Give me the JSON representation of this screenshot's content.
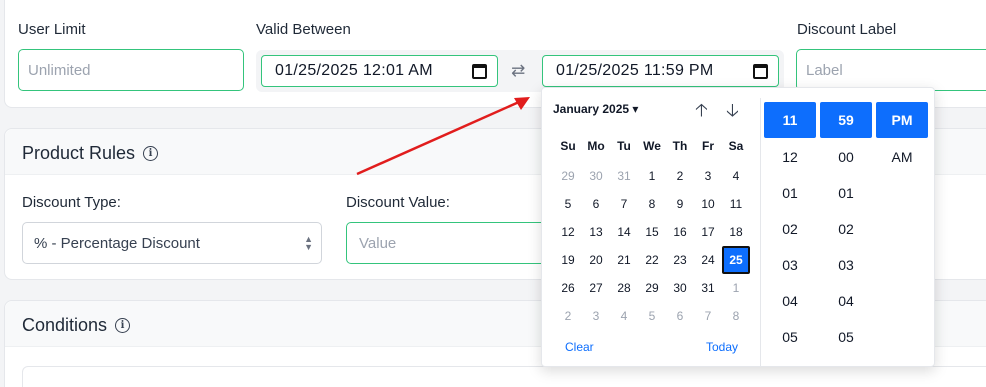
{
  "top": {
    "user_limit_label": "User Limit",
    "user_limit_placeholder": "Unlimited",
    "valid_between_label": "Valid Between",
    "start_datetime": "01/25/2025 12:01 AM",
    "end_datetime": "01/25/2025 11:59 PM",
    "discount_label_label": "Discount Label",
    "discount_label_placeholder": "Label"
  },
  "product_rules": {
    "title": "Product Rules",
    "discount_type_label": "Discount Type:",
    "discount_type_value": "% - Percentage Discount",
    "discount_value_label": "Discount Value:",
    "discount_value_placeholder": "Value"
  },
  "conditions": {
    "title": "Conditions"
  },
  "picker": {
    "month": "January 2025",
    "weekdays": [
      "Su",
      "Mo",
      "Tu",
      "We",
      "Th",
      "Fr",
      "Sa"
    ],
    "weeks": [
      [
        "29",
        "30",
        "31",
        "1",
        "2",
        "3",
        "4"
      ],
      [
        "5",
        "6",
        "7",
        "8",
        "9",
        "10",
        "11"
      ],
      [
        "12",
        "13",
        "14",
        "15",
        "16",
        "17",
        "18"
      ],
      [
        "19",
        "20",
        "21",
        "22",
        "23",
        "24",
        "25"
      ],
      [
        "26",
        "27",
        "28",
        "29",
        "30",
        "31",
        "1"
      ],
      [
        "2",
        "3",
        "4",
        "5",
        "6",
        "7",
        "8"
      ]
    ],
    "selected_day": "25",
    "clear_label": "Clear",
    "today_label": "Today",
    "hour_selected": "11",
    "minute_selected": "59",
    "ampm_selected": "PM",
    "hours": [
      "12",
      "01",
      "02",
      "03",
      "04",
      "05"
    ],
    "minutes": [
      "00",
      "01",
      "02",
      "03",
      "04",
      "05"
    ],
    "ampm": [
      "AM"
    ]
  },
  "colors": {
    "accent": "#0d6efd",
    "field_border": "#34c47c",
    "arrow": "#e11d1d"
  }
}
